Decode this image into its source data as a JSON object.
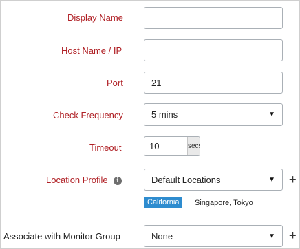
{
  "form": {
    "display_name": {
      "label": "Display Name",
      "value": ""
    },
    "host_name": {
      "label": "Host Name / IP",
      "value": ""
    },
    "port": {
      "label": "Port",
      "value": "21"
    },
    "check_frequency": {
      "label": "Check Frequency",
      "selected": "5 mins"
    },
    "timeout": {
      "label": "Timeout",
      "value": "10",
      "unit": "secs"
    },
    "location_profile": {
      "label": "Location Profile",
      "selected": "Default Locations",
      "primary_location": "California",
      "secondary_locations": "Singapore, Tokyo"
    },
    "monitor_group": {
      "label": "Associate with Monitor Group",
      "selected": "None"
    }
  },
  "icons": {
    "info": "info-icon",
    "add": "plus-icon",
    "dropdown": "caret-down-icon"
  },
  "colors": {
    "required_label": "#b02025",
    "tag_background": "#2e8ccf"
  }
}
